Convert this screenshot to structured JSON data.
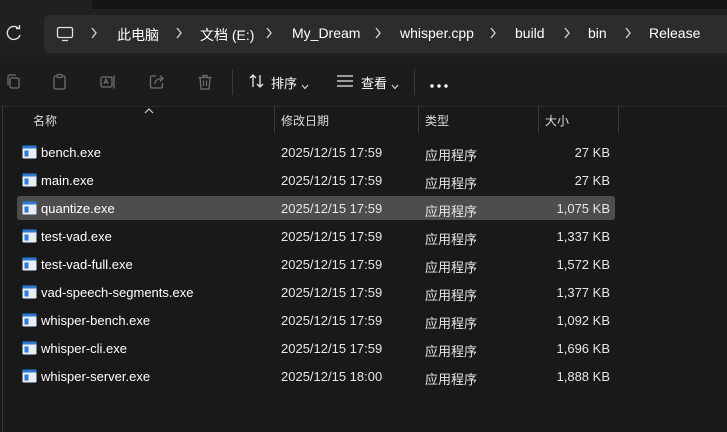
{
  "breadcrumb": [
    "此电脑",
    "文档 (E:)",
    "My_Dream",
    "whisper.cpp",
    "build",
    "bin",
    "Release"
  ],
  "toolbar": {
    "sort_label": "排序",
    "view_label": "查看",
    "more_label": "···"
  },
  "columns": {
    "name": "名称",
    "date": "修改日期",
    "type": "类型",
    "size": "大小"
  },
  "files": [
    {
      "name": "bench.exe",
      "date": "2025/12/15 17:59",
      "type": "应用程序",
      "size": "27 KB"
    },
    {
      "name": "main.exe",
      "date": "2025/12/15 17:59",
      "type": "应用程序",
      "size": "27 KB"
    },
    {
      "name": "quantize.exe",
      "date": "2025/12/15 17:59",
      "type": "应用程序",
      "size": "1,075 KB",
      "selected": true
    },
    {
      "name": "test-vad.exe",
      "date": "2025/12/15 17:59",
      "type": "应用程序",
      "size": "1,337 KB"
    },
    {
      "name": "test-vad-full.exe",
      "date": "2025/12/15 17:59",
      "type": "应用程序",
      "size": "1,572 KB"
    },
    {
      "name": "vad-speech-segments.exe",
      "date": "2025/12/15 17:59",
      "type": "应用程序",
      "size": "1,377 KB"
    },
    {
      "name": "whisper-bench.exe",
      "date": "2025/12/15 17:59",
      "type": "应用程序",
      "size": "1,092 KB"
    },
    {
      "name": "whisper-cli.exe",
      "date": "2025/12/15 17:59",
      "type": "应用程序",
      "size": "1,696 KB"
    },
    {
      "name": "whisper-server.exe",
      "date": "2025/12/15 18:00",
      "type": "应用程序",
      "size": "1,888 KB"
    }
  ],
  "colors": {
    "background": "#191919",
    "selected_row": "#4d4d4d",
    "address_bar": "#2c2c2c",
    "exe_icon_blue": "#2f7ad6"
  }
}
